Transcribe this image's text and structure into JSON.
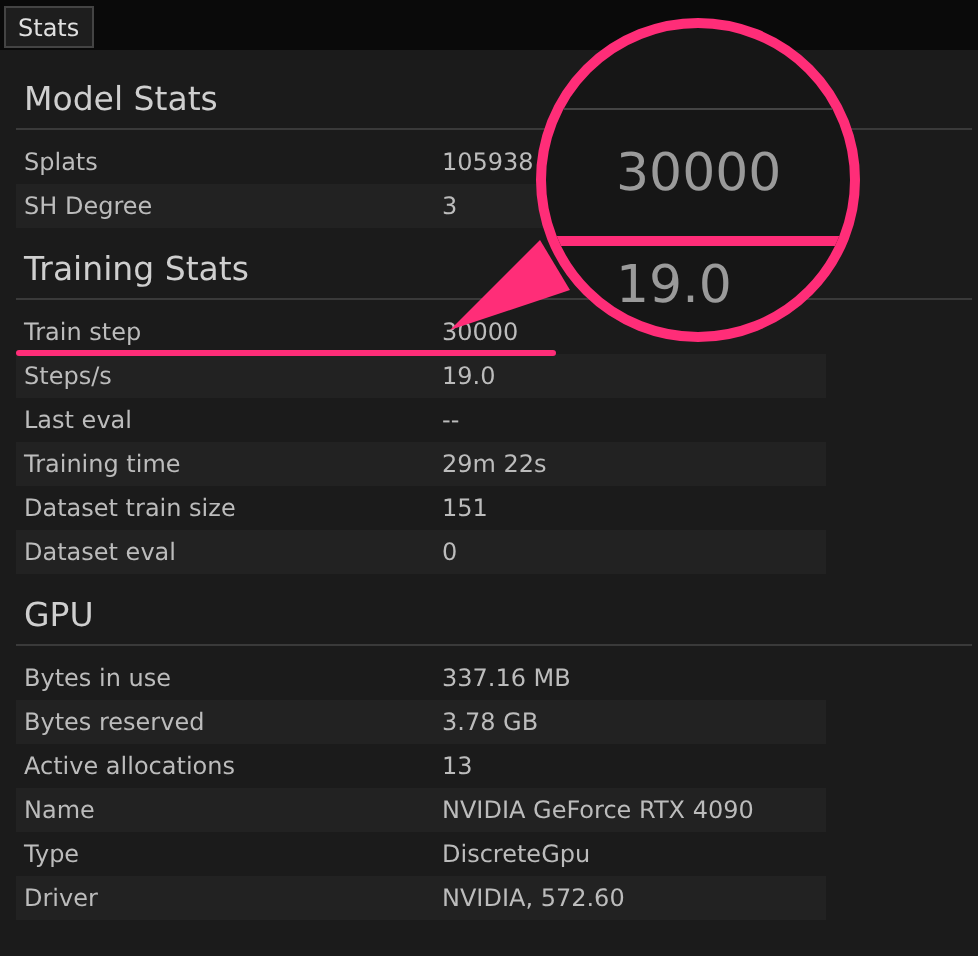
{
  "tabs": [
    {
      "label": "Stats",
      "selected": true
    }
  ],
  "sections": [
    {
      "title": "Model Stats",
      "rows": [
        {
          "label": "Splats",
          "value": "105938",
          "highlighted": false
        },
        {
          "label": "SH Degree",
          "value": "3",
          "highlighted": false
        }
      ]
    },
    {
      "title": "Training Stats",
      "rows": [
        {
          "label": "Train step",
          "value": "30000",
          "highlighted": true
        },
        {
          "label": "Steps/s",
          "value": "19.0",
          "highlighted": false
        },
        {
          "label": "Last eval",
          "value": "--",
          "highlighted": false
        },
        {
          "label": "Training time",
          "value": "29m 22s",
          "highlighted": false
        },
        {
          "label": "Dataset train size",
          "value": "151",
          "highlighted": false
        },
        {
          "label": "Dataset eval",
          "value": "0",
          "highlighted": false
        }
      ]
    },
    {
      "title": "GPU",
      "rows": [
        {
          "label": "Bytes in use",
          "value": "337.16 MB",
          "highlighted": false
        },
        {
          "label": "Bytes reserved",
          "value": "3.78 GB",
          "highlighted": false
        },
        {
          "label": "Active allocations",
          "value": "13",
          "highlighted": false
        },
        {
          "label": "Name",
          "value": "NVIDIA GeForce RTX 4090",
          "highlighted": false
        },
        {
          "label": "Type",
          "value": "DiscreteGpu",
          "highlighted": false
        },
        {
          "label": "Driver",
          "value": "NVIDIA, 572.60",
          "highlighted": false
        }
      ]
    }
  ],
  "magnifier": {
    "top_value": "30000",
    "bottom_value": "19.0"
  }
}
